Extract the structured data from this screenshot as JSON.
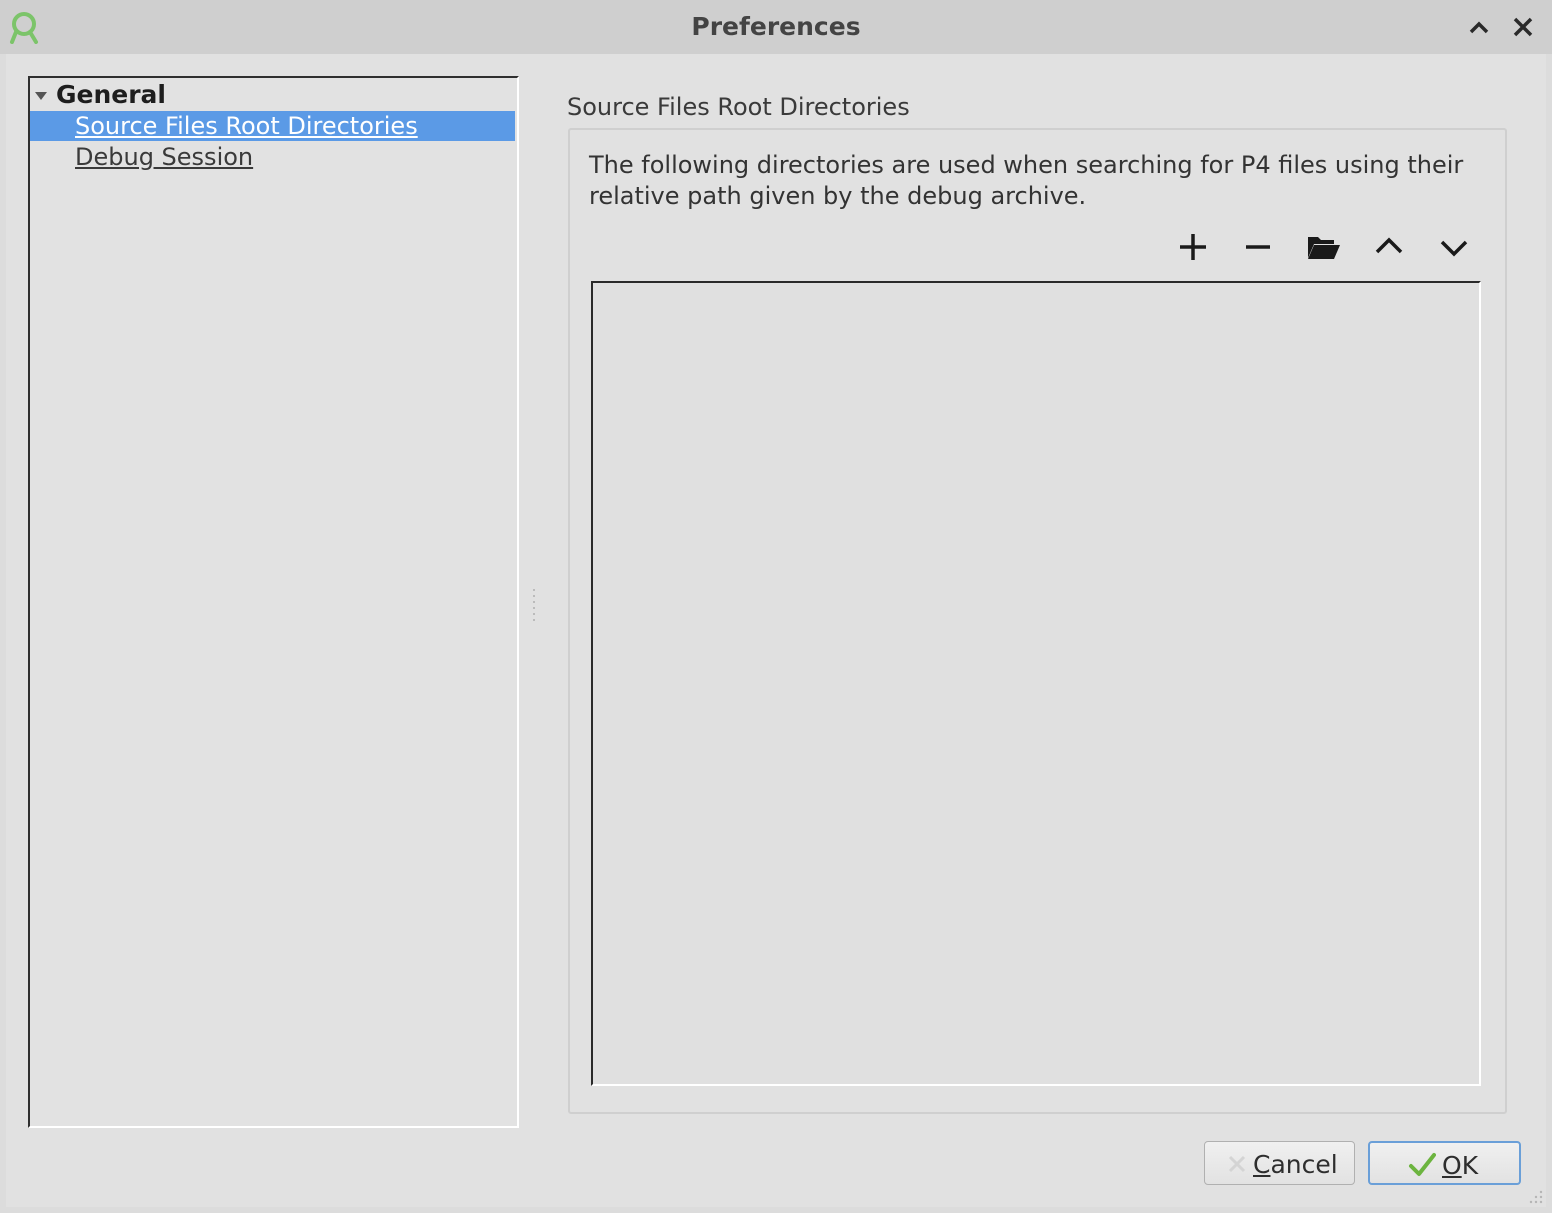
{
  "window": {
    "title": "Preferences"
  },
  "titlebar": {
    "app_icon": "app-logo-icon",
    "buttons": [
      "minimize-caret-up-icon",
      "close-icon"
    ]
  },
  "tree": {
    "group_label": "General",
    "items": [
      {
        "label": "Source Files Root Directories",
        "selected": true
      },
      {
        "label": "Debug Session",
        "selected": false
      }
    ]
  },
  "page": {
    "title": "Source Files Root Directories",
    "description": "The following directories are used when searching for P4 files using their relative path given by the debug archive.",
    "toolbar": [
      "add-icon",
      "remove-icon",
      "open-folder-icon",
      "move-up-icon",
      "move-down-icon"
    ],
    "directories": []
  },
  "buttons": {
    "cancel_label": "Cancel",
    "ok_label": "OK"
  },
  "colors": {
    "selection": "#5b9ae6",
    "ok_border": "#6a9fd8",
    "logo_green": "#7cc46a"
  }
}
